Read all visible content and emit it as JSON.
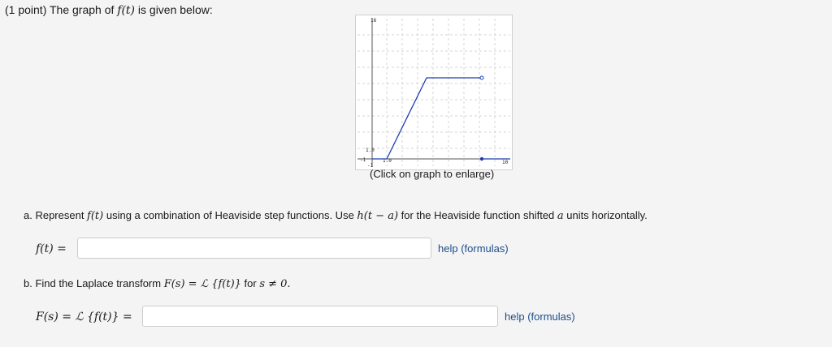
{
  "header": {
    "points": "(1 point) The graph of ",
    "f_of_t": "f(t)",
    "suffix": " is given below:"
  },
  "graph": {
    "caption": "(Click on graph to enlarge)",
    "x_min_label": "-1",
    "x_max_label": "10",
    "y_max_label": "16",
    "y_min_label": "-1",
    "y_one_label": "1.0",
    "x_one_label": "1.0",
    "line_color": "#1f3fb0"
  },
  "part_a": {
    "text_1": "a. Represent ",
    "f_of_t": "f(t)",
    "text_2": " using a combination of Heaviside step functions. Use ",
    "h_expr": "h(t − a)",
    "text_3": " for the Heaviside function shifted ",
    "a_var": "a",
    "text_4": " units horizontally.",
    "label": "f(t) =",
    "input_value": "",
    "help": "help (formulas)"
  },
  "part_b": {
    "text_1": "b. Find the Laplace transform ",
    "transform": "F(s) = ℒ {f(t)}",
    "text_2": " for ",
    "cond": "s ≠ 0.",
    "label": "F(s) = ℒ {f(t)} =",
    "input_value": "",
    "help": "help (formulas)"
  }
}
